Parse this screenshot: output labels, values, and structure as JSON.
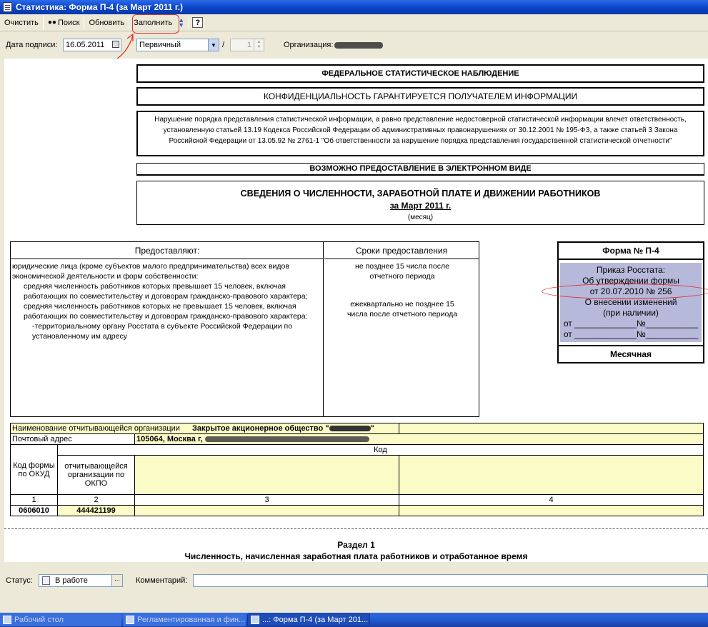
{
  "window": {
    "title": "Статистика: Форма П-4 (за Март 2011 г.)"
  },
  "toolbar": {
    "clear": "Очистить",
    "search": "Поиск",
    "refresh": "Обновить",
    "fill": "Заполнить",
    "help": "?"
  },
  "header": {
    "sign_date_label": "Дата подписи:",
    "sign_date": "16.05.2011",
    "report_type": "Первичный",
    "slash": "/",
    "number": "1",
    "org_label": "Организация:"
  },
  "form": {
    "federal": "ФЕДЕРАЛЬНОЕ СТАТИСТИЧЕСКОЕ НАБЛЮДЕНИЕ",
    "confidential": "КОНФИДЕНЦИАЛЬНОСТЬ ГАРАНТИРУЕТСЯ ПОЛУЧАТЕЛЕМ ИНФОРМАЦИИ",
    "warning": "Нарушение порядка представления статистической информации, а равно представление недостоверной статистической информации влечет ответственность, установленную статьей 13.19 Кодекса Российской Федерации об административных правонарушениях от 30.12.2001 № 195-ФЗ, а также статьей 3 Закона Российской Федерации от 13.05.92 № 2761-1 \"Об ответственности за нарушение порядка представления государственной статистической отчетности\"",
    "electronic": "ВОЗМОЖНО ПРЕДОСТАВЛЕНИЕ В ЭЛЕКТРОННОМ ВИДЕ",
    "title": "СВЕДЕНИЯ О ЧИСЛЕННОСТИ, ЗАРАБОТНОЙ ПЛАТЕ И ДВИЖЕНИИ РАБОТНИКОВ",
    "period": "за Март 2011 г.",
    "period_caption": "(месяц)",
    "provide_header": "Предоставляют:",
    "deadline_header": "Сроки предоставления",
    "provide_lines": [
      "юридические лица (кроме субъектов малого предпринимательства) всех видов экономической деятельности и форм собственности:",
      "средняя численность работников которых превышает 15 человек, включая работающих по совместительству и договорам гражданско-правового характера;",
      "средняя численность работников которых не превышает 15 человек, включая работающих по совместительству и договорам гражданско-правового характера:",
      "-территориальному органу Росстата в субъекте Российской Федерации по установленному им адресу"
    ],
    "deadline_1": "не позднее 15 числа после отчетного периода",
    "deadline_2": "ежеквартально не позднее 15 числа после отчетного периода",
    "form_no": "Форма № П-4",
    "order_lines": [
      "Приказ Росстата:",
      "Об утверждении формы",
      "от 20.07.2010 № 256",
      "О внесении изменений",
      "(при наличии)",
      "от _____________№___________",
      "от _____________№___________"
    ],
    "monthly": "Месячная",
    "org_name_label": "Наименование отчитывающейся организации",
    "org_name": "Закрытое акционерное общество \"",
    "org_name_end": "\"",
    "address_label": "Почтовый адрес",
    "address": "105064, Москва г,",
    "code_header": "Код",
    "okud_header": "Код формы по ОКУД",
    "okpo_header": "отчитывающейся организации по ОКПО",
    "col_nums": [
      "1",
      "2",
      "3",
      "4"
    ],
    "okud": "0606010",
    "okpo": "444421199",
    "section_title": "Раздел 1",
    "section_subtitle": "Численность, начисленная заработная плата работников и отработанное время"
  },
  "footer": {
    "status_label": "Статус:",
    "status_value": "В работе",
    "comment_label": "Комментарий:"
  },
  "taskbar": {
    "items": [
      "Рабочий стол",
      "Регламентированная и фин...",
      "...: Форма П-4 (за Март 201..."
    ]
  },
  "colors": {
    "accent_blue": "#0a43c8",
    "highlight_red": "#d33333",
    "form_yellow": "#fbfbc8",
    "order_box": "#b7b9da"
  }
}
